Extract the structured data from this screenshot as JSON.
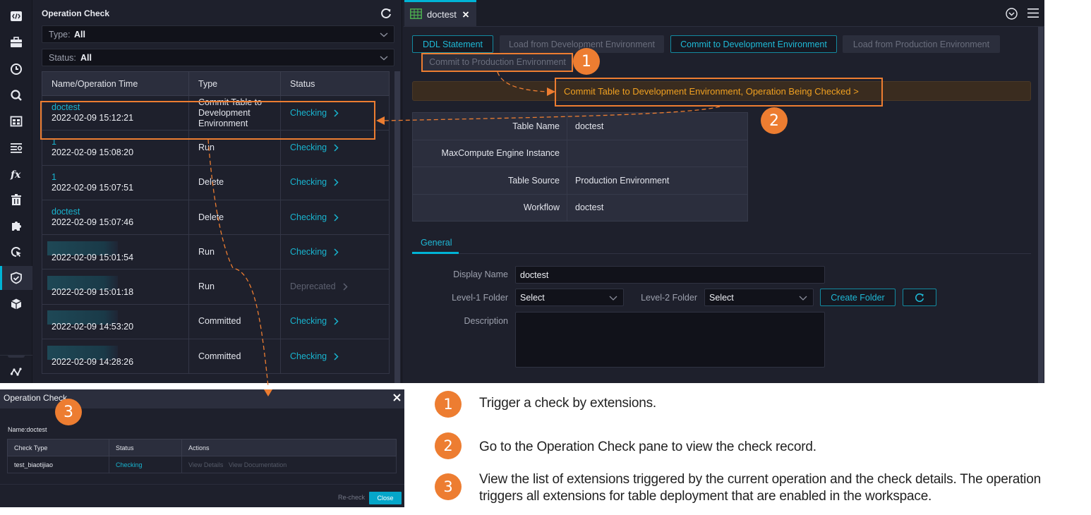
{
  "rail": {
    "items": [
      {
        "icon": "code-icon",
        "active": false
      },
      {
        "icon": "briefcase-icon",
        "active": false
      },
      {
        "icon": "clock-icon",
        "active": false
      },
      {
        "icon": "search-icon",
        "active": false
      },
      {
        "icon": "table-icon",
        "active": false
      },
      {
        "icon": "list-settings-icon",
        "active": false
      },
      {
        "icon": "function-icon",
        "active": false
      },
      {
        "icon": "trash-icon",
        "active": false
      },
      {
        "icon": "puzzle-icon",
        "active": false
      },
      {
        "icon": "cursor-search-icon",
        "active": false
      },
      {
        "icon": "shield-check-icon",
        "active": true
      },
      {
        "icon": "cube-icon",
        "active": false
      }
    ],
    "bottom_icon": "graph-icon"
  },
  "panel": {
    "title": "Operation Check",
    "filters": {
      "type_label": "Type:",
      "type_value": "All",
      "status_label": "Status:",
      "status_value": "All"
    },
    "columns": [
      "Name/Operation Time",
      "Type",
      "Status"
    ],
    "rows": [
      {
        "name": "doctest",
        "time": "2022-02-09 15:12:21",
        "type": "Commit Table to Development Environment",
        "status": "Checking",
        "blurred": false
      },
      {
        "name": "1",
        "time": "2022-02-09 15:08:20",
        "type": "Run",
        "status": "Checking",
        "blurred": false
      },
      {
        "name": "1",
        "time": "2022-02-09 15:07:51",
        "type": "Delete",
        "status": "Checking",
        "blurred": false
      },
      {
        "name": "doctest",
        "time": "2022-02-09 15:07:46",
        "type": "Delete",
        "status": "Checking",
        "blurred": false
      },
      {
        "name": "",
        "time": "2022-02-09 15:01:54",
        "type": "Run",
        "status": "Checking",
        "blurred": true
      },
      {
        "name": "",
        "time": "2022-02-09 15:01:18",
        "type": "Run",
        "status": "Deprecated",
        "blurred": true
      },
      {
        "name": "",
        "time": "2022-02-09 14:53:20",
        "type": "Committed",
        "status": "Checking",
        "blurred": true
      },
      {
        "name": "",
        "time": "2022-02-09 14:28:26",
        "type": "Committed",
        "status": "Checking",
        "blurred": true
      }
    ]
  },
  "editor": {
    "tab_label": "doctest",
    "buttons": {
      "ddl": "DDL Statement",
      "load_dev": "Load from Development Environment",
      "commit_dev": "Commit to Development Environment",
      "load_prod": "Load from Production Environment",
      "commit_prod": "Commit to Production Environment"
    },
    "banner": "Commit Table to Development Environment, Operation Being Checked >",
    "properties": [
      {
        "key": "Table Name",
        "value": "doctest"
      },
      {
        "key": "MaxCompute Engine Instance",
        "value": ""
      },
      {
        "key": "Table Source",
        "value": "Production Environment"
      },
      {
        "key": "Workflow",
        "value": "doctest"
      }
    ],
    "section_tab": "General",
    "form": {
      "display_name_label": "Display Name",
      "display_name_value": "doctest",
      "level1_label": "Level-1 Folder",
      "level1_value": "Select",
      "level2_label": "Level-2 Folder",
      "level2_value": "Select",
      "create_folder": "Create Folder",
      "description_label": "Description",
      "description_value": ""
    }
  },
  "modal": {
    "title": "Operation Check",
    "name_line": "Name:doctest",
    "columns": [
      "Check Type",
      "Status",
      "Actions"
    ],
    "rows": [
      {
        "check_type": "test_biaotijiao",
        "status": "Checking",
        "actions": [
          "View Details",
          "View Documentation"
        ]
      }
    ],
    "recheck": "Re-check",
    "close": "Close"
  },
  "annotations": {
    "badges": [
      "1",
      "2",
      "3"
    ],
    "legend": [
      {
        "num": "1",
        "text": "Trigger a check by extensions."
      },
      {
        "num": "2",
        "text": "Go to the Operation Check pane to view the check record."
      },
      {
        "num": "3",
        "text": "View the list of extensions triggered by the current operation and the check details. The operation triggers all extensions for table deployment that are enabled in the workspace."
      }
    ],
    "color": "#ed7d31"
  },
  "colors": {
    "accent": "#00b4d6",
    "link": "#18b4cf",
    "warning_text": "#f0a020",
    "background": "#1e202c"
  }
}
